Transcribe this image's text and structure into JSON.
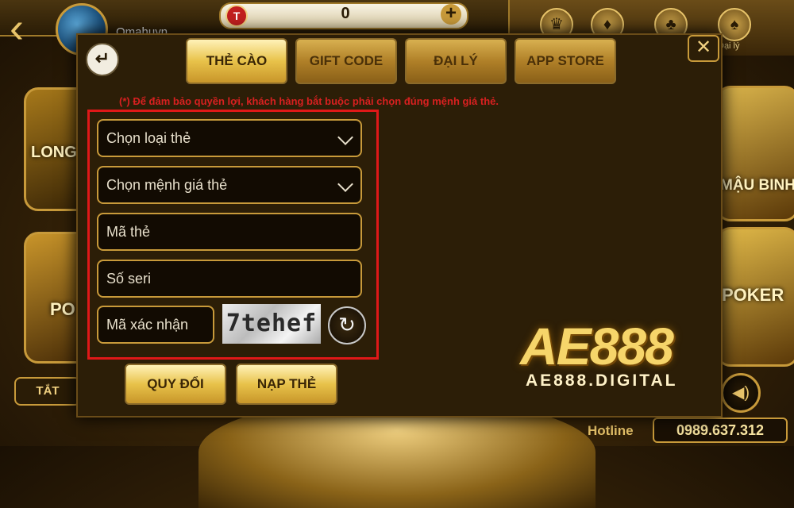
{
  "header": {
    "username": "Omahuyn",
    "coins": "0",
    "coin_symbol": "T",
    "nav_label": "Đại lý"
  },
  "games": {
    "left_top": "LONG",
    "left_bottom": "PO",
    "right_top": "MẬU BINH",
    "right_bottom": "POKER"
  },
  "bottom": {
    "tat_label": "TẮT",
    "hotline_label": "Hotline",
    "hotline_number": "0989.637.312"
  },
  "modal": {
    "tabs": [
      {
        "label": "THẺ CÀO",
        "active": true
      },
      {
        "label": "GIFT CODE",
        "active": false
      },
      {
        "label": "ĐẠI LÝ",
        "active": false
      },
      {
        "label": "APP STORE",
        "active": false
      }
    ],
    "notice": "(*) Để đảm bảo quyền lợi, khách hàng bắt buộc phải chọn đúng mệnh giá thẻ.",
    "card_type_select": "Chọn loại thẻ",
    "card_value_select": "Chọn mệnh giá thẻ",
    "card_code_placeholder": "Mã thẻ",
    "serial_placeholder": "Số seri",
    "captcha_placeholder": "Mã xác nhận",
    "captcha_text": "7tehef",
    "buttons": {
      "exchange": "QUY ĐỔI",
      "topup": "NẠP THẺ"
    }
  },
  "watermark": {
    "logo": "AE888",
    "site": "AE888.DIGITAL"
  },
  "colors": {
    "gold": "#e8c46a",
    "modal_bg": "#2c1e07",
    "notice_red": "#d82020",
    "frame_red": "#e01818"
  }
}
